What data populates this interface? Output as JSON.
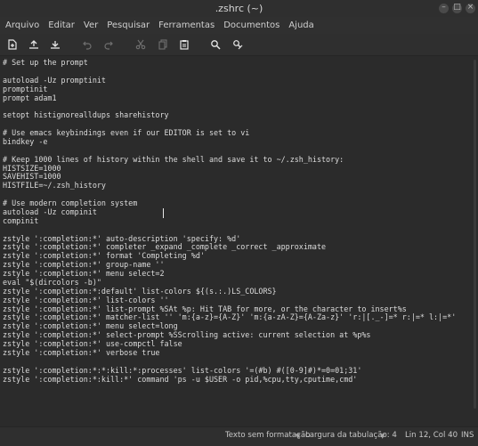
{
  "window": {
    "title": ".zshrc (~)"
  },
  "menubar": [
    "Arquivo",
    "Editar",
    "Ver",
    "Pesquisar",
    "Ferramentas",
    "Documentos",
    "Ajuda"
  ],
  "toolbar": {
    "buttons": [
      {
        "name": "new-document",
        "icon": "new-file-icon",
        "enabled": true
      },
      {
        "name": "open",
        "icon": "open-icon",
        "enabled": true
      },
      {
        "name": "save",
        "icon": "save-icon",
        "enabled": true
      },
      {
        "name": "undo",
        "icon": "undo-icon",
        "enabled": false
      },
      {
        "name": "redo",
        "icon": "redo-icon",
        "enabled": false
      },
      {
        "name": "cut",
        "icon": "cut-icon",
        "enabled": false
      },
      {
        "name": "copy",
        "icon": "copy-icon",
        "enabled": false
      },
      {
        "name": "paste",
        "icon": "paste-icon",
        "enabled": true
      },
      {
        "name": "find",
        "icon": "search-icon",
        "enabled": true
      },
      {
        "name": "replace",
        "icon": "replace-icon",
        "enabled": true
      }
    ]
  },
  "editor": {
    "lines": [
      "# Set up the prompt",
      "",
      "autoload -Uz promptinit",
      "promptinit",
      "prompt adam1",
      "",
      "setopt histignorealldups sharehistory",
      "",
      "# Use emacs keybindings even if our EDITOR is set to vi",
      "bindkey -e",
      "",
      "# Keep 1000 lines of history within the shell and save it to ~/.zsh_history:",
      "HISTSIZE=1000",
      "SAVEHIST=1000",
      "HISTFILE=~/.zsh_history",
      "",
      "# Use modern completion system",
      "autoload -Uz compinit",
      "compinit",
      "",
      "zstyle ':completion:*' auto-description 'specify: %d'",
      "zstyle ':completion:*' completer _expand _complete _correct _approximate",
      "zstyle ':completion:*' format 'Completing %d'",
      "zstyle ':completion:*' group-name ''",
      "zstyle ':completion:*' menu select=2",
      "eval \"$(dircolors -b)\"",
      "zstyle ':completion:*:default' list-colors ${(s.:.)LS_COLORS}",
      "zstyle ':completion:*' list-colors ''",
      "zstyle ':completion:*' list-prompt %SAt %p: Hit TAB for more, or the character to insert%s",
      "zstyle ':completion:*' matcher-list '' 'm:{a-z}={A-Z}' 'm:{a-zA-Z}={A-Za-z}' 'r:|[._-]=* r:|=* l:|=*'",
      "zstyle ':completion:*' menu select=long",
      "zstyle ':completion:*' select-prompt %SScrolling active: current selection at %p%s",
      "zstyle ':completion:*' use-compctl false",
      "zstyle ':completion:*' verbose true",
      "",
      "zstyle ':completion:*:*:kill:*:processes' list-colors '=(#b) #([0-9]#)*=0=01;31'",
      "zstyle ':completion:*:kill:*' command 'ps -u $USER -o pid,%cpu,tty,cputime,cmd'"
    ]
  },
  "statusbar": {
    "syntax": "Texto sem formatação",
    "tab_width": "Largura da tabulação: 4",
    "position": "Lin 12, Col 40",
    "mode": "INS"
  },
  "colors": {
    "background": "#2b2b2b",
    "text": "#dcdcdc",
    "chrome": "#2f2f2f"
  }
}
